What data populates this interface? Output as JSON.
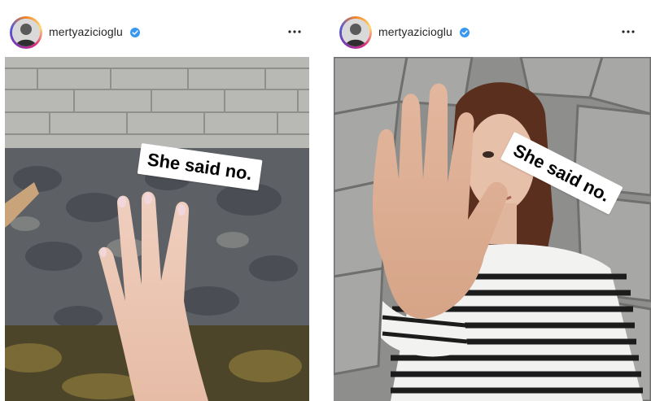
{
  "posts": [
    {
      "username": "mertyazicioglu",
      "verified": true,
      "sticker_text": "She said no."
    },
    {
      "username": "mertyazicioglu",
      "verified": true,
      "sticker_text": "She said no."
    }
  ],
  "colors": {
    "verified_badge": "#3897f0",
    "username_text": "#262626",
    "more_dots": "#262626"
  },
  "icons": [
    "avatar",
    "verified-badge-icon",
    "more-options-icon"
  ]
}
